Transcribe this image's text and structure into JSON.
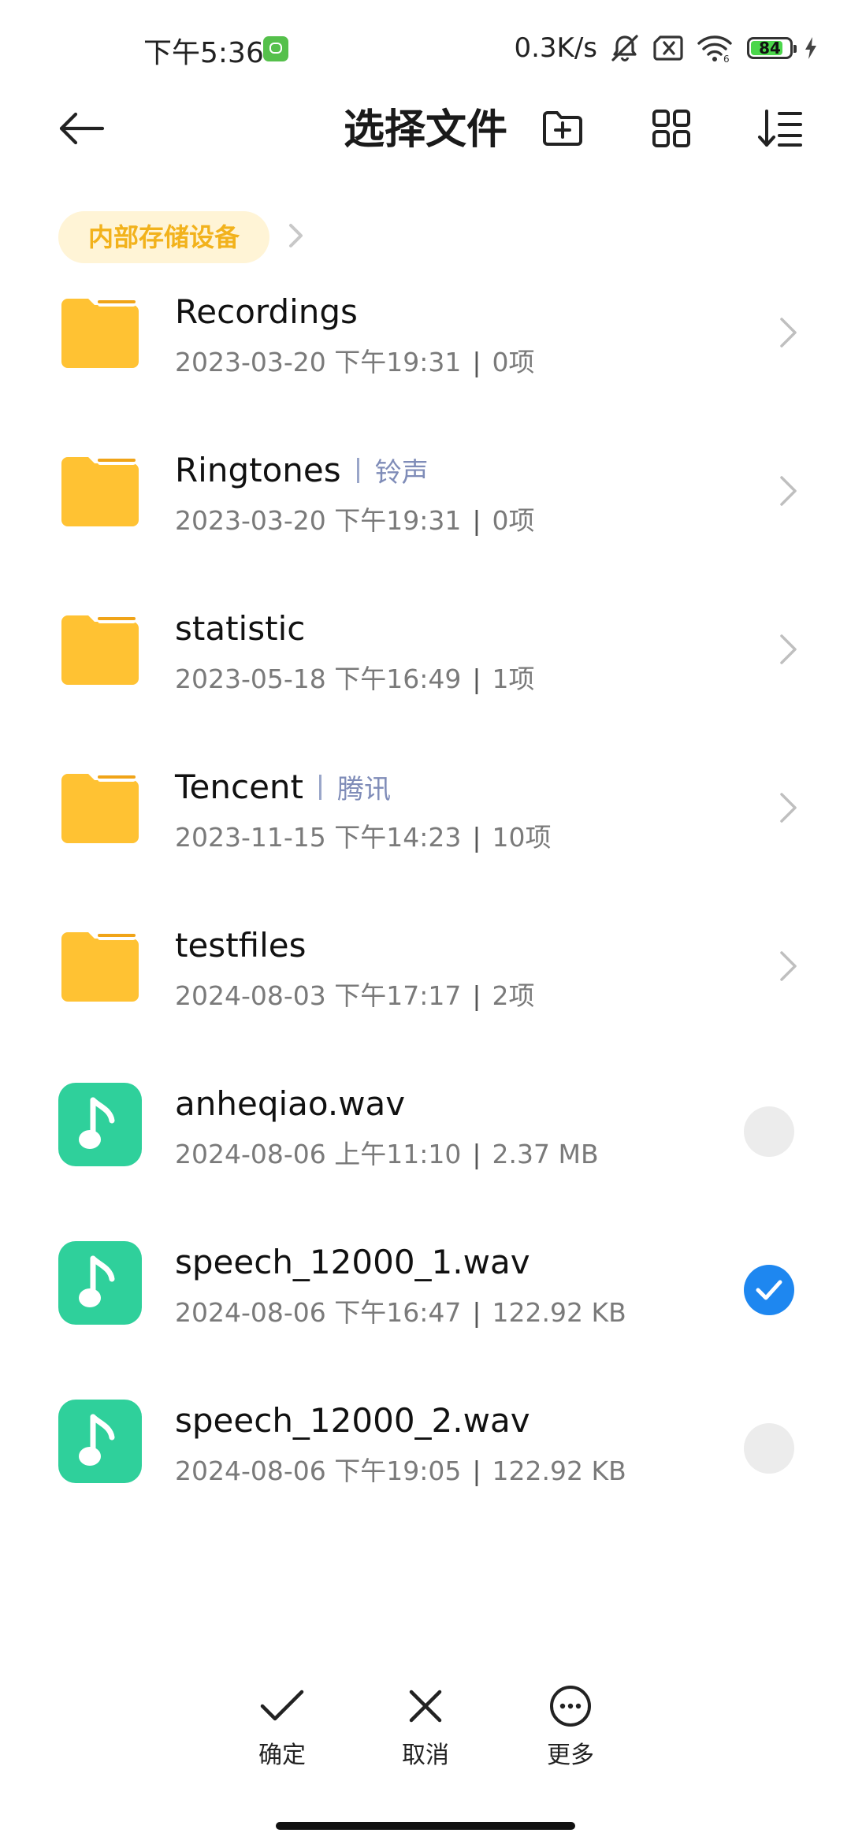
{
  "status_bar": {
    "time": "下午5:36",
    "network_speed": "0.3K/s",
    "battery_level": "84",
    "battery_fraction": 0.84,
    "icons": [
      "app-notification-icon",
      "mute-icon",
      "sim-disabled-icon",
      "wifi-icon",
      "battery-icon",
      "charging-icon"
    ]
  },
  "header": {
    "title": "选择文件",
    "icons": [
      "back-arrow-icon",
      "new-folder-icon",
      "grid-view-icon",
      "sort-icon"
    ]
  },
  "breadcrumb": {
    "current": "内部存储设备"
  },
  "items": [
    {
      "type": "folder",
      "name": "Recordings",
      "alias": "",
      "date": "2023-03-20 下午19:31",
      "info": "0项"
    },
    {
      "type": "folder",
      "name": "Ringtones",
      "alias": "铃声",
      "date": "2023-03-20 下午19:31",
      "info": "0项"
    },
    {
      "type": "folder",
      "name": "statistic",
      "alias": "",
      "date": "2023-05-18 下午16:49",
      "info": "1项"
    },
    {
      "type": "folder",
      "name": "Tencent",
      "alias": "腾讯",
      "date": "2023-11-15 下午14:23",
      "info": "10项"
    },
    {
      "type": "folder",
      "name": "testfiles",
      "alias": "",
      "date": "2024-08-03 下午17:17",
      "info": "2项"
    },
    {
      "type": "file",
      "name": "anheqiao.wav",
      "alias": "",
      "date": "2024-08-06 上午11:10",
      "info": "2.37 MB",
      "selected": false
    },
    {
      "type": "file",
      "name": "speech_12000_1.wav",
      "alias": "",
      "date": "2024-08-06 下午16:47",
      "info": "122.92 KB",
      "selected": true
    },
    {
      "type": "file",
      "name": "speech_12000_2.wav",
      "alias": "",
      "date": "2024-08-06 下午19:05",
      "info": "122.92 KB",
      "selected": false
    }
  ],
  "actions": {
    "confirm": "确定",
    "cancel": "取消",
    "more": "更多"
  },
  "colors": {
    "folder": "#ffc233",
    "audio_file": "#2fd09b",
    "selected": "#1e87f0",
    "breadcrumb_text": "#f2b21c",
    "breadcrumb_bg": "#fff4d6"
  }
}
